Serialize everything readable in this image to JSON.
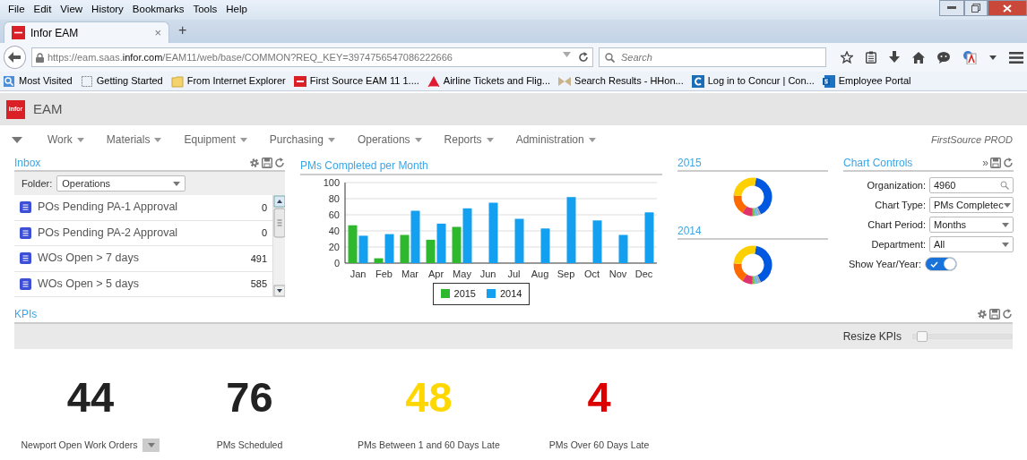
{
  "browser": {
    "menu": [
      "File",
      "Edit",
      "View",
      "History",
      "Bookmarks",
      "Tools",
      "Help"
    ],
    "tab": {
      "title": "Infor EAM",
      "close": "×",
      "selected": true
    },
    "new_tab": "+",
    "url": {
      "scheme": "https://eam.saas.",
      "host": "infor.com",
      "path": "/EAM11/web/base/COMMON?REQ_KEY=3974756547086222666"
    },
    "search": {
      "placeholder": "Search"
    },
    "bookmarks": [
      {
        "kind": "library",
        "label": "Most Visited"
      },
      {
        "kind": "page",
        "label": "Getting Started"
      },
      {
        "kind": "folder",
        "label": "From Internet Explorer"
      },
      {
        "kind": "logo",
        "label": "First Source EAM 11 1...."
      },
      {
        "kind": "triangle",
        "label": "Airline Tickets and Flig..."
      },
      {
        "kind": "bowtie",
        "label": "Search Results - HHon..."
      },
      {
        "kind": "csquare",
        "label": "Log in to Concur | Con..."
      },
      {
        "kind": "ssquare",
        "label": "Employee Portal"
      }
    ]
  },
  "app": {
    "logo": "infor",
    "title": "EAM",
    "menu": [
      "Work",
      "Materials",
      "Equipment",
      "Purchasing",
      "Operations",
      "Reports",
      "Administration"
    ],
    "environment": "FirstSource PROD"
  },
  "inbox": {
    "title": "Inbox",
    "folder_label": "Folder:",
    "folder": "Operations",
    "items": [
      {
        "label": "POs Pending PA-1 Approval",
        "count": "0"
      },
      {
        "label": "POs Pending PA-2 Approval",
        "count": "0"
      },
      {
        "label": "WOs Open > 7 days",
        "count": "491"
      },
      {
        "label": "WOs Open > 5 days",
        "count": "585"
      }
    ]
  },
  "chart": {
    "title": "PMs Completed per Month",
    "chart_data": {
      "type": "bar",
      "categories": [
        "Jan",
        "Feb",
        "Mar",
        "Apr",
        "May",
        "Jun",
        "Jul",
        "Aug",
        "Sep",
        "Oct",
        "Nov",
        "Dec"
      ],
      "series": [
        {
          "name": "2015",
          "color": "#2eb82e",
          "values": [
            47,
            6,
            35,
            29,
            45,
            null,
            null,
            null,
            null,
            null,
            null,
            null
          ]
        },
        {
          "name": "2014",
          "color": "#14a0f0",
          "values": [
            34,
            36,
            65,
            49,
            68,
            75,
            55,
            43,
            82,
            53,
            35,
            63
          ]
        }
      ],
      "ylim": [
        0,
        100
      ],
      "yticks": [
        0,
        20,
        40,
        60,
        80,
        100
      ],
      "grid": true,
      "legend": true
    }
  },
  "donuts": [
    {
      "title": "2015"
    },
    {
      "title": "2014"
    }
  ],
  "controls": {
    "title": "Chart Controls",
    "expand": "»",
    "fields": [
      {
        "kind": "lookup",
        "label": "Organization:",
        "value": "4960"
      },
      {
        "kind": "select",
        "label": "Chart Type:",
        "value": "PMs Completec"
      },
      {
        "kind": "select",
        "label": "Chart Period:",
        "value": "Months"
      },
      {
        "kind": "select",
        "label": "Department:",
        "value": "All"
      }
    ],
    "toggle": {
      "label": "Show Year/Year:",
      "on": true
    }
  },
  "kpis": {
    "title": "KPIs",
    "resize_label": "Resize KPIs",
    "slider": {
      "level": 0.04
    },
    "items": [
      {
        "value": "44",
        "label": "Newport Open Work Orders",
        "color": "#222222",
        "menu": true
      },
      {
        "value": "76",
        "label": "PMs Scheduled",
        "color": "#222222",
        "menu": false
      },
      {
        "value": "48",
        "label": "PMs Between 1 and 60 Days Late",
        "color": "#ffd700",
        "menu": false
      },
      {
        "value": "4",
        "label": "PMs Over 60 Days Late",
        "color": "#dd0000",
        "menu": false
      }
    ]
  }
}
